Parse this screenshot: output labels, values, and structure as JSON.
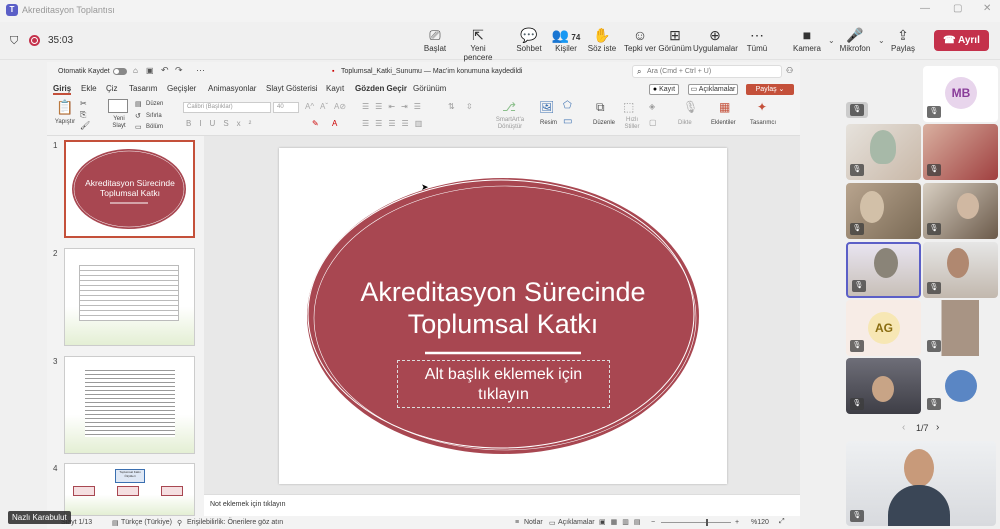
{
  "window": {
    "title": "Akreditasyon Toplantısı"
  },
  "meeting": {
    "timer": "35:03",
    "buttons": [
      {
        "label": "Başlat",
        "icon": "start-icon"
      },
      {
        "label": "Yeni pencere",
        "icon": "new-window-icon"
      },
      {
        "label": "Sohbet",
        "icon": "chat-icon"
      },
      {
        "label": "Kişiler",
        "icon": "people-icon",
        "count": "74"
      },
      {
        "label": "Söz iste",
        "icon": "raise-hand-icon"
      },
      {
        "label": "Tepki ver",
        "icon": "react-icon"
      },
      {
        "label": "Görünüm",
        "icon": "view-icon"
      },
      {
        "label": "Uygulamalar",
        "icon": "apps-icon"
      },
      {
        "label": "Tümü",
        "icon": "more-icon"
      },
      {
        "label": "Kamera",
        "icon": "camera-icon"
      },
      {
        "label": "Mikrofon",
        "icon": "mic-off-icon"
      },
      {
        "label": "Paylaş",
        "icon": "share-icon"
      }
    ],
    "leave_label": "Ayrıl"
  },
  "ppt": {
    "autosave": "Otomatik Kaydet",
    "doc_title": "Toplumsal_Katki_Sunumu — Mac'im konumuna kaydedildi",
    "search_placeholder": "Ara (Cmd + Ctrl + U)",
    "tabs": [
      "Giriş",
      "Ekle",
      "Çiz",
      "Tasarım",
      "Geçişler",
      "Animasyonlar",
      "Slayt Gösterisi",
      "Kayıt",
      "Gözden Geçir",
      "Görünüm"
    ],
    "record_btn": "Kayıt",
    "comments_btn": "Açıklamalar",
    "share_btn": "Paylaş",
    "ribbon": {
      "paste": "Yapıştır",
      "new_slide": "Yeni\nSlayt",
      "layout": "Düzen",
      "reset": "Sıfırla",
      "section": "Bölüm",
      "font_name": "Calibri (Başlıklar)",
      "font_size": "40",
      "smartart": "SmartArt'a\nDönüştür",
      "picture": "Resim",
      "arrange": "Düzenle",
      "quick_styles": "Hızlı\nStiller",
      "dictate": "Dikte",
      "addins": "Eklentiler",
      "designer": "Tasarımcı"
    },
    "slides": [
      {
        "num": "1",
        "title": "Akreditasyon Sürecinde Toplumsal Katkı"
      },
      {
        "num": "2"
      },
      {
        "num": "3"
      },
      {
        "num": "4",
        "title": "Toplumsal Katkı Ölçütleri"
      }
    ],
    "main_slide": {
      "title": "Akreditasyon Sürecinde Toplumsal Katkı",
      "subtitle_placeholder": "Alt başlık eklemek için tıklayın"
    },
    "notes_placeholder": "Not eklemek için tıklayın",
    "status": {
      "slide_counter": "Slayt 1/13",
      "language": "Türkçe (Türkiye)",
      "accessibility": "Erişilebilirlik: Önerilere göz atın",
      "notes": "Notlar",
      "comments": "Açıklamalar",
      "zoom": "%120"
    }
  },
  "participants": {
    "tiles": [
      {
        "initials": "MB",
        "color": "#e8d5ec",
        "text_color": "#8a3d9a"
      },
      {
        "initials": "AG",
        "color": "#f7e7b4",
        "text_color": "#8a6d10"
      }
    ],
    "pager": "1/7",
    "presenter_name": "Nazlı Karabulut"
  },
  "colors": {
    "accent": "#a84751",
    "teams": "#5b5fc7",
    "leave": "#c4314b"
  }
}
